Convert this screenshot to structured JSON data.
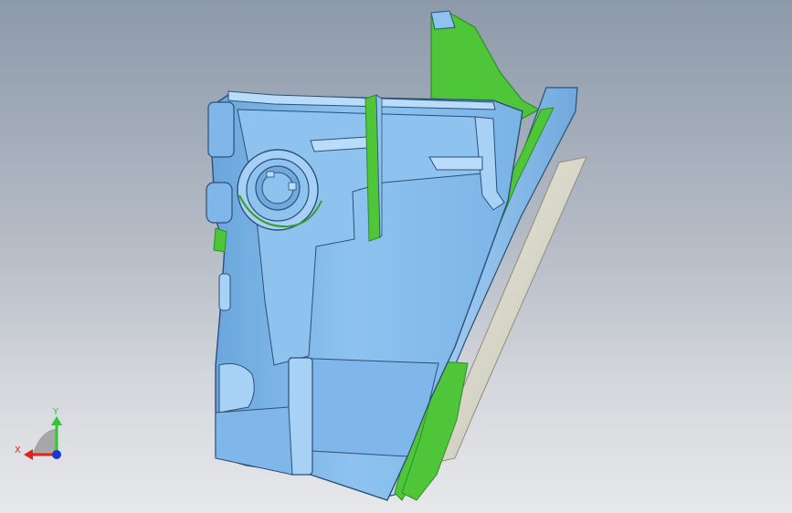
{
  "viewport": {
    "background_top": "#8d9aaa",
    "background_bottom": "#e7e8ea"
  },
  "colors": {
    "part_body": "#8ec3f0",
    "part_highlight": "#b9dcfa",
    "part_shadow": "#5f95c8",
    "edge": "#2d4f74",
    "green_face": "#4fc63a",
    "green_dark": "#2d8f24",
    "gasket": "#d8d6c8",
    "axis_x": "#e0241b",
    "axis_y": "#2fc82f",
    "axis_z": "#1a34d6"
  },
  "triad": {
    "x_label": "X",
    "y_label": "Y",
    "x_icon": "x-axis-arrow-icon",
    "y_icon": "y-axis-arrow-icon",
    "z_icon": "z-axis-dot-icon"
  }
}
